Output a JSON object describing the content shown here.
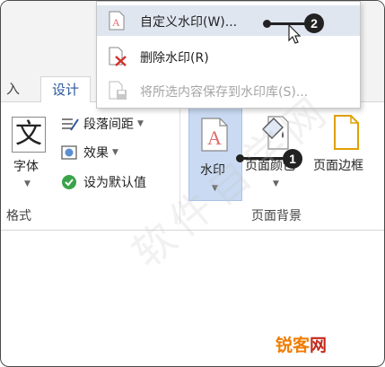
{
  "tabs": {
    "partial": "入",
    "active": "设计"
  },
  "font_group": {
    "big_char": "文",
    "label": "字体",
    "group_label": "格式"
  },
  "format_items": [
    {
      "label": "段落间距",
      "icon": "paragraph-spacing-icon",
      "has_dropdown": true
    },
    {
      "label": "效果",
      "icon": "effects-icon",
      "has_dropdown": true
    },
    {
      "label": "设为默认值",
      "icon": "check-circle-icon",
      "has_dropdown": false
    }
  ],
  "page_bg_group": {
    "watermark_label": "水印",
    "page_color_label": "页面颜色",
    "page_border_label": "页面边框",
    "group_label": "页面背景"
  },
  "watermark_menu": {
    "items": [
      {
        "label": "自定义水印(W)...",
        "state": "hover",
        "icon": "custom-watermark-icon"
      },
      {
        "label": "删除水印(R)",
        "state": "normal",
        "icon": "remove-watermark-icon"
      },
      {
        "label": "将所选内容保存到水印库(S)...",
        "state": "disabled",
        "icon": "save-to-gallery-icon"
      }
    ]
  },
  "callouts": {
    "one": "1",
    "two": "2"
  },
  "watermark_overlay": "软件自学网",
  "brand": {
    "part1": "锐客",
    "part2": "网"
  },
  "colors": {
    "accent": "#2b579a",
    "hover": "#dfe6f0",
    "brand_orange": "#f07c00",
    "brand_red": "#c22a1e"
  }
}
